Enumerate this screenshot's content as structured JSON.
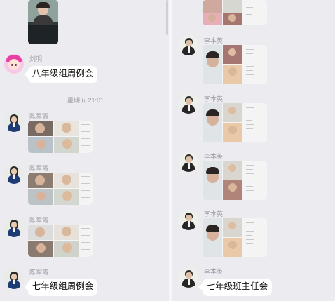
{
  "left": {
    "messages": [
      {
        "sender": "刘明",
        "text": "八年级组周例会"
      },
      {
        "timestamp": "星期五 21:01"
      },
      {
        "sender": "陈军霞"
      },
      {
        "sender": "陈军霞"
      },
      {
        "sender": "陈军霞"
      },
      {
        "sender": "陈军霞",
        "text": "七年级组周例会"
      }
    ]
  },
  "right": {
    "messages": [
      {
        "sender": "李本英"
      },
      {
        "sender": "李本英"
      },
      {
        "sender": "李本英"
      },
      {
        "sender": "李本英"
      },
      {
        "sender": "李本英",
        "text": "七年级班主任会"
      }
    ]
  },
  "colors": {
    "background": "#ebebf0",
    "bubble": "#ffffff",
    "name_text": "#9a9aa2"
  },
  "icons": {
    "avatar_liuming": "cartoon-avatar-icon",
    "avatar_chenjunxia": "woman-avatar-icon",
    "avatar_libenying": "man-avatar-icon"
  }
}
